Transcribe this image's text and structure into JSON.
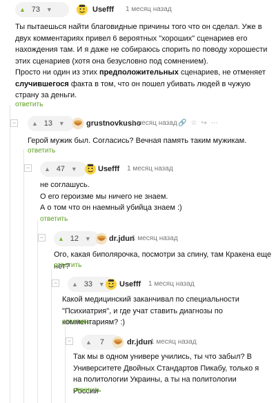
{
  "colors": {
    "reply_link": "#5a9e1e",
    "vote_active": "#7fb32f",
    "vote_bg": "#f2f2f2"
  },
  "reply_label": "ответить",
  "comments": [
    {
      "score": "73",
      "user": "Usefff",
      "date": "1 месяц назад",
      "avatar_icon": "yellow-emoji-avatar",
      "paragraphs": [
        "Ты пытаешься найти благовидные причины того что он сделал. Уже в двух комментариях привел 6 вероятных \"хороших\" сценариев его нахождения там. И я даже не собираюсь спорить по поводу хорошести этих сценариев (хотя она безусловно под сомнением)."
      ],
      "p2_before": "Просто ни один из этих ",
      "p2_bold1": "предположительных",
      "p2_mid": " сценариев, не отменяет ",
      "p2_bold2": "случившегося",
      "p2_after": " факта в том, что он пошел убивать людей в чужую страну за деньги."
    },
    {
      "score": "13",
      "user": "grustnovkusno",
      "date": "1 месяц назад",
      "avatar_icon": "bowl-avatar",
      "text": "Герой мужик был. Согласись? Вечная память таким мужикам."
    },
    {
      "score": "47",
      "user": "Usefff",
      "date": "1 месяц назад",
      "avatar_icon": "yellow-emoji-avatar",
      "lines": [
        "не соглашусь.",
        "О его героизме мы ничего не знаем.",
        "А о том что он наемный убийца знаем :)"
      ]
    },
    {
      "score": "12",
      "user": "dr.jdun",
      "date": "1 месяц назад",
      "avatar_icon": "bowl-avatar",
      "text": "Ого, какая биполярочка, посмотри за спину, там Кракена еще нет?"
    },
    {
      "score": "33",
      "user": "Usefff",
      "date": "1 месяц назад",
      "avatar_icon": "yellow-emoji-avatar",
      "text": "Какой медицинский заканчивал по специальности \"Психиатрия\", и где учат ставить диагнозы по комментариям? :)"
    },
    {
      "score": "7",
      "user": "dr.jdun",
      "date": "1 месяц назад",
      "avatar_icon": "bowl-avatar",
      "text": "Так мы в одном универе учились, ты что забыл? В Университете Двойных Стандартов Пикабу, только я на политологии Украины, а ты на политологии России"
    }
  ]
}
